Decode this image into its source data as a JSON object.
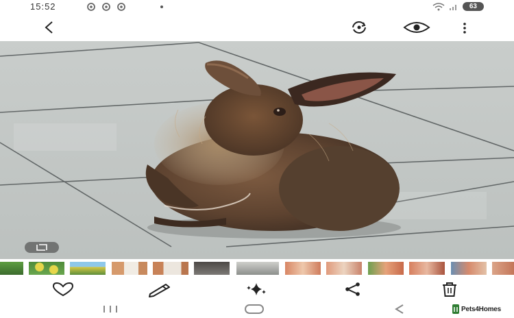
{
  "status_bar": {
    "time": "15:52",
    "battery": "63",
    "notification_icons": [
      "notification-icon",
      "notification-icon",
      "notification-icon"
    ],
    "right_icons": [
      "wifi-icon",
      "signal-icon",
      "battery-icon"
    ]
  },
  "app_bar": {
    "back_icon": "chevron-left-icon",
    "actions": [
      "rotate-icon",
      "eye-icon",
      "more-vertical-icon"
    ]
  },
  "photo": {
    "subject": "photo",
    "crop_toggle_icon": "crop-icon"
  },
  "thumbnails": {
    "count": 13,
    "selected_index": 6
  },
  "actions": {
    "icons": [
      "heart-icon",
      "edit-icon",
      "sparkle-icon",
      "share-icon",
      "trash-icon"
    ]
  },
  "navigation": {
    "icons": [
      "recent-apps-icon",
      "home-icon",
      "back-icon"
    ]
  },
  "watermark": {
    "text": "Pets4Homes"
  },
  "colors": {
    "accent": "#2e7d32",
    "floor": "#c6cac8",
    "rabbit": "#6b4a34"
  }
}
